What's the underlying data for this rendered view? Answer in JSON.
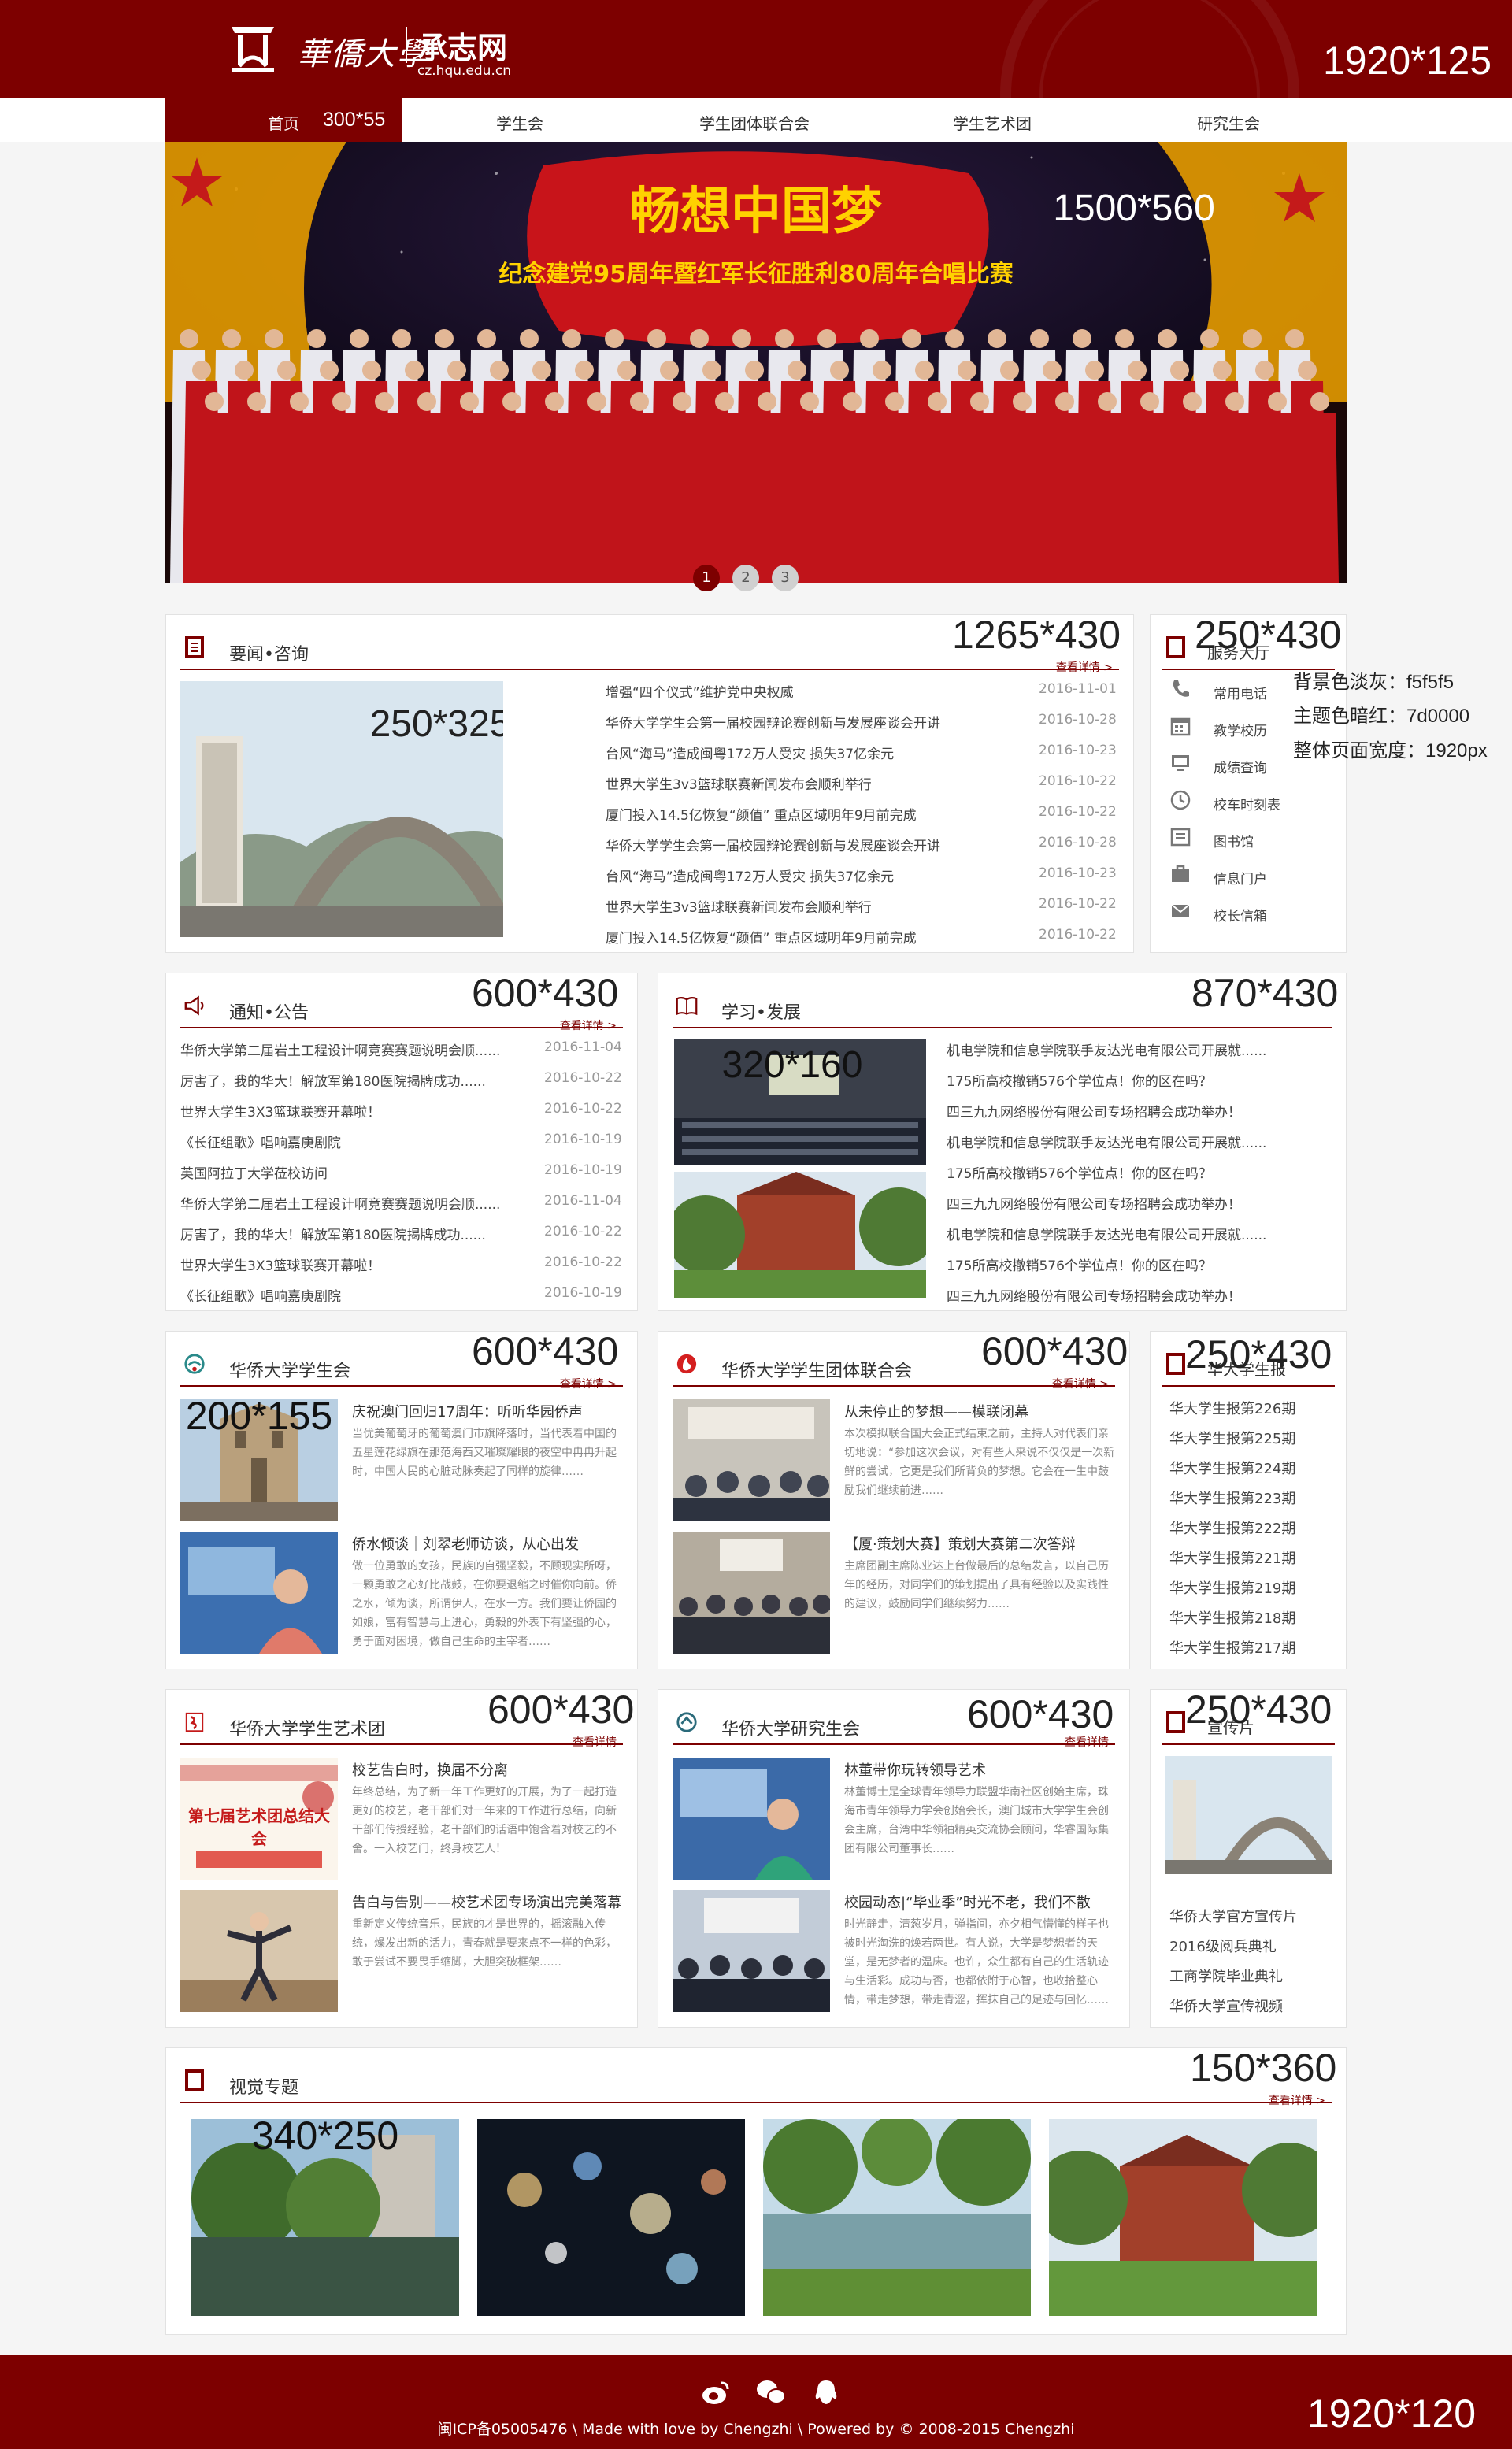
{
  "header": {
    "school_name": "華僑大學",
    "site_name": "承志网",
    "site_url": "cz.hqu.edu.cn",
    "size_note": "1920*125",
    "bg_color": "#7d0000"
  },
  "nav": {
    "home": "首页",
    "home_size": "300*55",
    "items": [
      "学生会",
      "学生团体联合会",
      "学生艺术团",
      "研究生会"
    ]
  },
  "banner": {
    "line1": "畅想中国梦",
    "line2": "纪念建党95周年暨红军长征胜利80周年合唱比赛",
    "size_note": "1500*560",
    "dots": [
      "1",
      "2",
      "3"
    ]
  },
  "news": {
    "title": "要闻•咨询",
    "more": "查看详情 >",
    "size_note": "1265*430",
    "thumb_size": "250*325",
    "items": [
      {
        "t": "增强“四个仪式”维护党中央权威",
        "d": "2016-11-01"
      },
      {
        "t": "华侨大学学生会第一届校园辩论赛创新与发展座谈会开讲",
        "d": "2016-10-28"
      },
      {
        "t": "台风“海马”造成闽粤172万人受灾 损失37亿余元",
        "d": "2016-10-23"
      },
      {
        "t": "世界大学生3v3篮球联赛新闻发布会顺利举行",
        "d": "2016-10-22"
      },
      {
        "t": "厦门投入14.5亿恢复“颜值” 重点区域明年9月前完成",
        "d": "2016-10-22"
      },
      {
        "t": "华侨大学学生会第一届校园辩论赛创新与发展座谈会开讲",
        "d": "2016-10-28"
      },
      {
        "t": "台风“海马”造成闽粤172万人受灾 损失37亿余元",
        "d": "2016-10-23"
      },
      {
        "t": "世界大学生3v3篮球联赛新闻发布会顺利举行",
        "d": "2016-10-22"
      },
      {
        "t": "厦门投入14.5亿恢复“颜值” 重点区域明年9月前完成",
        "d": "2016-10-22"
      }
    ]
  },
  "quicklinks": {
    "title": "服务大厅",
    "size_note": "250*430",
    "items": [
      {
        "label": "常用电话",
        "icon": "phone-icon"
      },
      {
        "label": "教学校历",
        "icon": "calendar-icon"
      },
      {
        "label": "成绩查询",
        "icon": "monitor-icon"
      },
      {
        "label": "校车时刻表",
        "icon": "clock-icon"
      },
      {
        "label": "图书馆",
        "icon": "book-icon"
      },
      {
        "label": "信息门户",
        "icon": "briefcase-icon"
      },
      {
        "label": "校长信箱",
        "icon": "mail-icon"
      }
    ]
  },
  "notes": {
    "bg": "背景色淡灰：f5f5f5",
    "theme": "主题色暗红：7d0000",
    "width": "整体页面宽度：1920px"
  },
  "notice": {
    "title": "通知•公告",
    "more": "查看详情 >",
    "size_note": "600*430",
    "items": [
      {
        "t": "华侨大学第二届岩土工程设计啊竞赛赛题说明会顺......",
        "d": "2016-11-04"
      },
      {
        "t": "厉害了，我的华大！解放军第180医院揭牌成功......",
        "d": "2016-10-22"
      },
      {
        "t": "世界大学生3X3篮球联赛开幕啦！",
        "d": "2016-10-22"
      },
      {
        "t": "《长征组歌》唱响嘉庚剧院",
        "d": "2016-10-19"
      },
      {
        "t": "英国阿拉丁大学莅校访问",
        "d": "2016-10-19"
      },
      {
        "t": "华侨大学第二届岩土工程设计啊竞赛赛题说明会顺......",
        "d": "2016-11-04"
      },
      {
        "t": "厉害了，我的华大！解放军第180医院揭牌成功......",
        "d": "2016-10-22"
      },
      {
        "t": "世界大学生3X3篮球联赛开幕啦！",
        "d": "2016-10-22"
      },
      {
        "t": "《长征组歌》唱响嘉庚剧院",
        "d": "2016-10-19"
      }
    ]
  },
  "study": {
    "title": "学习•发展",
    "size_note": "870*430",
    "thumb_size": "320*160",
    "items": [
      "机电学院和信息学院联手友达光电有限公司开展就......",
      "175所高校撤销576个学位点！你的区在吗？",
      "四三九九网络股份有限公司专场招聘会成功举办！",
      "机电学院和信息学院联手友达光电有限公司开展就......",
      "175所高校撤销576个学位点！你的区在吗？",
      "四三九九网络股份有限公司专场招聘会成功举办！",
      "机电学院和信息学院联手友达光电有限公司开展就......",
      "175所高校撤销576个学位点！你的区在吗？",
      "四三九九网络股份有限公司专场招聘会成功举办！"
    ]
  },
  "su": {
    "title": "华侨大学学生会",
    "more": "查看详情 >",
    "size_note": "600*430",
    "thumb_size": "200*155",
    "a1_title": "庆祝澳门回归17周年：听听华园侨声",
    "a1_text": "当优美葡萄牙的葡萄澳门市旗降落时，当代表着中国的五星莲花绿旗在那范海西又璀璨耀眼的夜空中冉冉升起时，中国人民的心脏动脉奏起了同样的旋律……",
    "a2_title": "侨水倾谈｜刘翠老师访谈，从心出发",
    "a2_text": "做一位勇敢的女孩，民族的自强坚毅，不顾现实所呀，一颗勇敢之心好比战鼓，在你要退缩之时催你向前。侨之水，倾为谈，所谓伊人，在水一方。我们要让侨园的如娘，富有智慧与上进心，勇毅的外表下有坚强的心，勇于面对困境，做自己生命的主宰者……"
  },
  "union": {
    "title": "华侨大学学生团体联合会",
    "more": "查看详情 >",
    "size_note": "600*430",
    "a1_title": "从未停止的梦想——模联闭幕",
    "a1_text": "本次模拟联合国大会正式结束之前，主持人对代表们亲切地说：“参加这次会议，对有些人来说不仅仅是一次新鲜的尝试，它更是我们所背负的梦想。它会在一生中鼓励我们继续前进……",
    "a2_title": "【厦·策划大赛】策划大赛第二次答辩",
    "a2_text": "主席团副主席陈业达上台做最后的总结发言，以自己历年的经历，对同学们的策划提出了具有经验以及实践性的建议，鼓励同学们继续努力……"
  },
  "paper": {
    "title": "华大学生报",
    "size_note": "250*430",
    "items": [
      "华大学生报第226期",
      "华大学生报第225期",
      "华大学生报第224期",
      "华大学生报第223期",
      "华大学生报第222期",
      "华大学生报第221期",
      "华大学生报第219期",
      "华大学生报第218期",
      "华大学生报第217期"
    ]
  },
  "art": {
    "title": "华侨大学学生艺术团",
    "more": "查看详情",
    "size_note": "600*430",
    "banner_text": "第七届艺术团总结大会",
    "a1_title": "校艺告白时，换届不分离",
    "a1_text": "年终总结，为了新一年工作更好的开展，为了一起打造更好的校艺，老干部们对一年来的工作进行总结，向新干部们传授经验，老干部们的话语中饱含着对校艺的不舍。一入校艺门，终身校艺人！",
    "a2_title": "告白与告别——校艺术团专场演出完美落幕",
    "a2_text": "重新定义传统音乐，民族的才是世界的，摇滚融入传统，燥发出新的活力，青春就是要来点不一样的色彩，敢于尝试不要畏手缩脚，大胆突破框架……"
  },
  "grad": {
    "title": "华侨大学研究生会",
    "more": "查看详情",
    "size_note": "600*430",
    "a1_title": "林董带你玩转领导艺术",
    "a1_text": "林董博士是全球青年领导力联盟华南社区创始主席，珠海市青年领导力学会创始会长，澳门城市大学学生会创会主席，台湾中华领袖精英交流协会顾问，华睿国际集团有限公司董事长……",
    "a2_title": "校园动态|“毕业季”时光不老，我们不散",
    "a2_text": "时光静走，清葱岁月，弹指间，亦夕相气懵懂的样子也被时光淘洗的焕若两世。有人说，大学是梦想者的天堂，是无梦者的温床。也许，众生都有自己的生活轨迹与生活彩。成功与否，也都依附于心智，也收拾整心情，带走梦想，带走青涩，挥抹自己的足迹与回忆……"
  },
  "promo": {
    "title": "宣传片",
    "size_note": "250*430",
    "items": [
      "华侨大学官方宣传片",
      "2016级阅兵典礼",
      "工商学院毕业典礼",
      "华侨大学宣传视频"
    ]
  },
  "visual": {
    "title": "视觉专题",
    "more": "查看详情 >",
    "size_note": "150*360",
    "thumb_size": "340*250"
  },
  "footer": {
    "copyright": "闽ICP备05005476 \\ Made with love by Chengzhi \\ Powered by © 2008-2015 Chengzhi",
    "size_note": "1920*120",
    "icons": [
      "weibo-icon",
      "wechat-icon",
      "qq-icon"
    ]
  }
}
